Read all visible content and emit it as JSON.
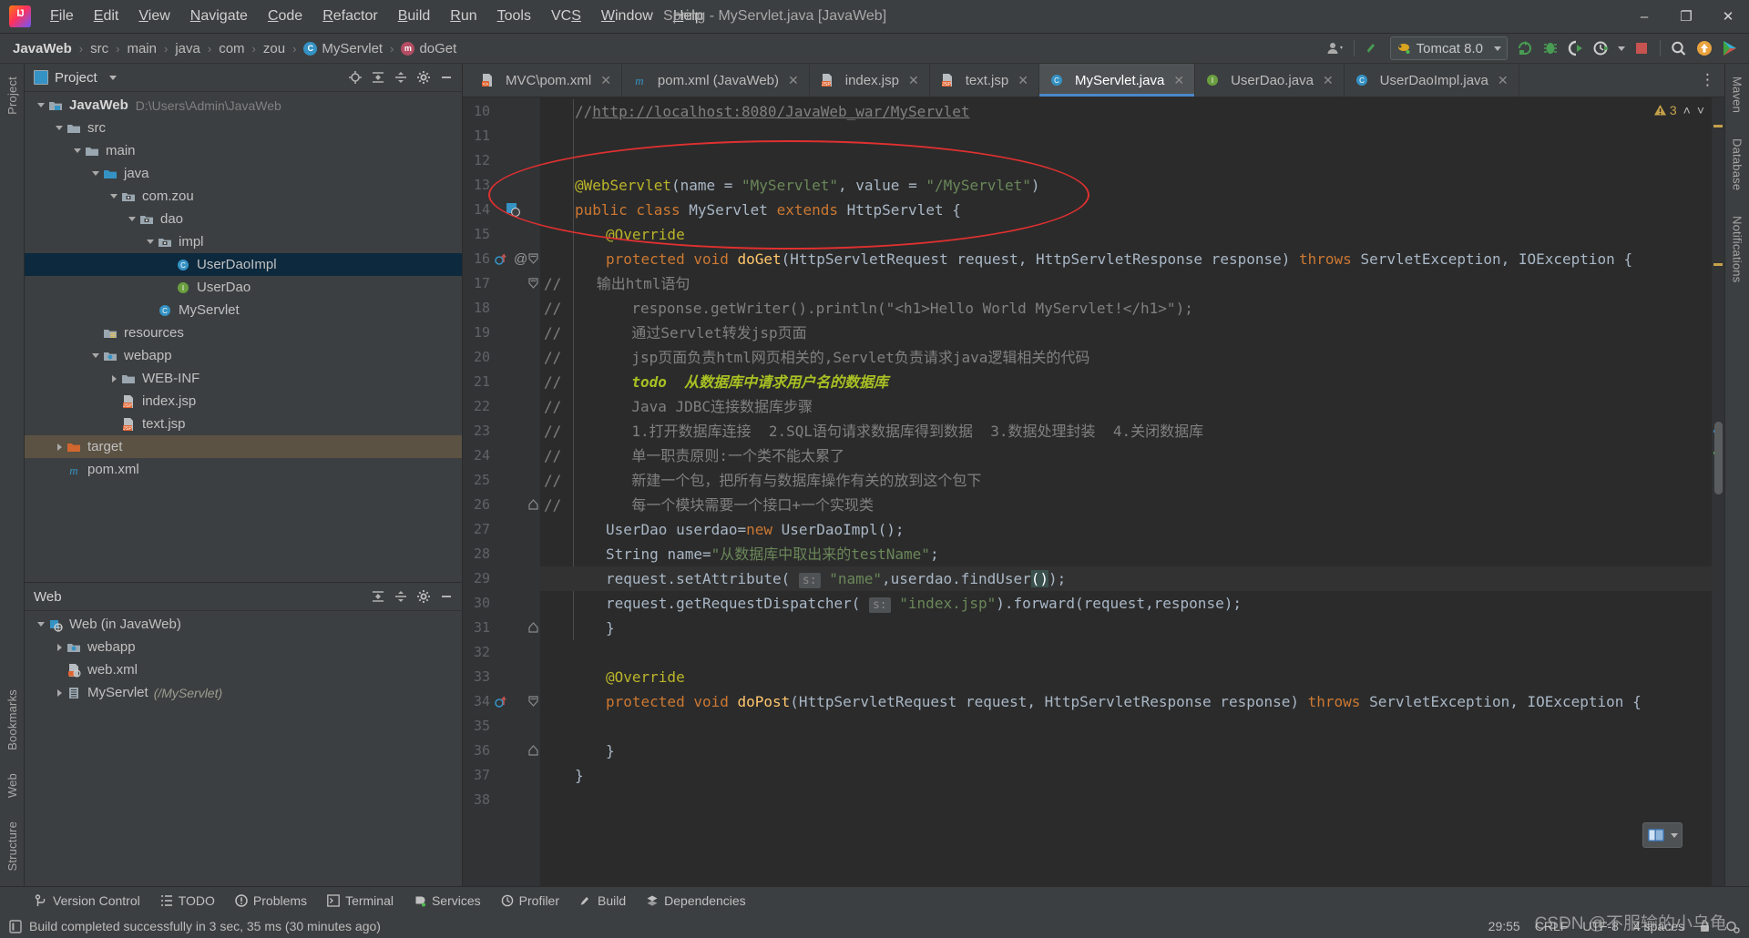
{
  "window": {
    "title": "Spring - MyServlet.java [JavaWeb]",
    "minimize": "–",
    "maximize": "❐",
    "close": "✕"
  },
  "menubar": [
    {
      "label": "File",
      "mnemonic": "F"
    },
    {
      "label": "Edit",
      "mnemonic": "E"
    },
    {
      "label": "View",
      "mnemonic": "V"
    },
    {
      "label": "Navigate",
      "mnemonic": "N"
    },
    {
      "label": "Code",
      "mnemonic": "C"
    },
    {
      "label": "Refactor",
      "mnemonic": "R"
    },
    {
      "label": "Build",
      "mnemonic": "B"
    },
    {
      "label": "Run",
      "mnemonic": "R"
    },
    {
      "label": "Tools",
      "mnemonic": "T"
    },
    {
      "label": "VCS",
      "mnemonic": "S"
    },
    {
      "label": "Window",
      "mnemonic": "W"
    },
    {
      "label": "Help",
      "mnemonic": "H"
    }
  ],
  "breadcrumb": [
    {
      "label": "JavaWeb",
      "icon": "",
      "bold": true
    },
    {
      "label": "src",
      "icon": ""
    },
    {
      "label": "main",
      "icon": ""
    },
    {
      "label": "java",
      "icon": ""
    },
    {
      "label": "com",
      "icon": ""
    },
    {
      "label": "zou",
      "icon": ""
    },
    {
      "label": "MyServlet",
      "icon": "class-icon"
    },
    {
      "label": "doGet",
      "icon": "method-icon"
    }
  ],
  "toolbar": {
    "account_label": "account-icon",
    "back_label": "back-arrow-icon",
    "run_config": "Tomcat 8.0",
    "buttons": [
      "rerun-icon",
      "debug-icon",
      "run-with-coverage-icon",
      "profiler-icon",
      "stop-icon",
      "search-everywhere-icon",
      "update-icon",
      "ide-icon"
    ]
  },
  "project_panel": {
    "title": "Project",
    "actions": [
      "locate-icon",
      "expand-all-icon",
      "collapse-all-icon",
      "settings-icon",
      "hide-icon"
    ],
    "tree": [
      {
        "label": "JavaWeb",
        "sub": "D:\\Users\\Admin\\JavaWeb",
        "depth": 0,
        "state": "open",
        "icon": "module-folder-icon",
        "bold": true
      },
      {
        "label": "src",
        "depth": 1,
        "state": "open",
        "icon": "folder-icon"
      },
      {
        "label": "main",
        "depth": 2,
        "state": "open",
        "icon": "folder-icon"
      },
      {
        "label": "java",
        "depth": 3,
        "state": "open",
        "icon": "source-folder-icon"
      },
      {
        "label": "com.zou",
        "depth": 4,
        "state": "open",
        "icon": "package-icon"
      },
      {
        "label": "dao",
        "depth": 5,
        "state": "open",
        "icon": "package-icon"
      },
      {
        "label": "impl",
        "depth": 6,
        "state": "open",
        "icon": "package-icon"
      },
      {
        "label": "UserDaoImpl",
        "depth": 7,
        "state": "leaf",
        "icon": "class-icon",
        "selected": true
      },
      {
        "label": "UserDao",
        "depth": 7,
        "state": "leaf",
        "icon": "interface-icon"
      },
      {
        "label": "MyServlet",
        "depth": 6,
        "state": "leaf",
        "icon": "class-icon"
      },
      {
        "label": "resources",
        "depth": 3,
        "state": "leaf",
        "icon": "resource-folder-icon"
      },
      {
        "label": "webapp",
        "depth": 3,
        "state": "open",
        "icon": "web-folder-icon"
      },
      {
        "label": "WEB-INF",
        "depth": 4,
        "state": "closed",
        "icon": "folder-icon"
      },
      {
        "label": "index.jsp",
        "depth": 4,
        "state": "leaf",
        "icon": "jsp-icon"
      },
      {
        "label": "text.jsp",
        "depth": 4,
        "state": "leaf",
        "icon": "jsp-icon"
      },
      {
        "label": "target",
        "depth": 1,
        "state": "closed",
        "icon": "excluded-folder-icon",
        "highlighted": true
      },
      {
        "label": "pom.xml",
        "depth": 1,
        "state": "leaf",
        "icon": "maven-icon"
      }
    ]
  },
  "web_panel": {
    "title": "Web",
    "actions": [
      "expand-all-icon",
      "collapse-all-icon",
      "settings-icon",
      "hide-icon"
    ],
    "tree": [
      {
        "label": "Web (in JavaWeb)",
        "depth": 0,
        "state": "open",
        "icon": "web-module-icon"
      },
      {
        "label": "webapp",
        "depth": 1,
        "state": "closed",
        "icon": "web-folder-icon"
      },
      {
        "label": "web.xml",
        "depth": 1,
        "state": "leaf",
        "icon": "webxml-icon"
      },
      {
        "label": "MyServlet",
        "mapping": "(/MyServlet)",
        "depth": 1,
        "state": "closed",
        "icon": "servlet-icon"
      }
    ]
  },
  "left_strip": [
    "Project",
    "Bookmarks",
    "Web",
    "Structure"
  ],
  "right_strip": [
    "Maven",
    "Database",
    "Notifications"
  ],
  "editor_tabs": [
    {
      "label": "MVC\\pom.xml",
      "icon": "xml-icon",
      "active": false
    },
    {
      "label": "pom.xml (JavaWeb)",
      "icon": "maven-icon",
      "active": false
    },
    {
      "label": "index.jsp",
      "icon": "jsp-icon",
      "active": false
    },
    {
      "label": "text.jsp",
      "icon": "jsp-icon",
      "active": false
    },
    {
      "label": "MyServlet.java",
      "icon": "class-icon",
      "active": true
    },
    {
      "label": "UserDao.java",
      "icon": "interface-icon",
      "active": false
    },
    {
      "label": "UserDaoImpl.java",
      "icon": "class-icon",
      "active": false
    }
  ],
  "inspection": {
    "warning_count": "3",
    "warning_icon": "warning-triangle-icon",
    "up_icon": "˄",
    "down_icon": "˅"
  },
  "code": {
    "first_line": 10,
    "current_line": 29,
    "lines": [
      {
        "n": 10,
        "tokens": [
          {
            "t": "//",
            "c": "cmt"
          },
          {
            "t": "http://localhost:8080/JavaWeb_war/MyServlet",
            "c": "lnk"
          }
        ],
        "indent": 1
      },
      {
        "n": 11,
        "tokens": [],
        "indent": 0
      },
      {
        "n": 12,
        "tokens": [],
        "indent": 0
      },
      {
        "n": 13,
        "tokens": [
          {
            "t": "@WebServlet",
            "c": "ann"
          },
          {
            "t": "(name = ",
            "c": "typ"
          },
          {
            "t": "\"MyServlet\"",
            "c": "str"
          },
          {
            "t": ", value = ",
            "c": "typ"
          },
          {
            "t": "\"/MyServlet\"",
            "c": "str"
          },
          {
            "t": ")",
            "c": "typ"
          }
        ],
        "indent": 1
      },
      {
        "n": 14,
        "tokens": [
          {
            "t": "public class ",
            "c": "kw"
          },
          {
            "t": "MyServlet ",
            "c": "typ"
          },
          {
            "t": "extends ",
            "c": "kw"
          },
          {
            "t": "HttpServlet {",
            "c": "typ"
          }
        ],
        "indent": 1,
        "gutter": "bean-icon"
      },
      {
        "n": 15,
        "tokens": [
          {
            "t": "@Override",
            "c": "ann"
          }
        ],
        "indent": 2
      },
      {
        "n": 16,
        "tokens": [
          {
            "t": "protected void ",
            "c": "kw"
          },
          {
            "t": "doGet",
            "c": "fn"
          },
          {
            "t": "(HttpServletRequest request, HttpServletResponse response) ",
            "c": "typ"
          },
          {
            "t": "throws ",
            "c": "kw"
          },
          {
            "t": "ServletException, IOException {",
            "c": "typ"
          }
        ],
        "indent": 2,
        "gutter": "override-icon"
      },
      {
        "n": 17,
        "tokens": [
          {
            "t": "//    输出html语句",
            "c": "cmt"
          }
        ],
        "indent": 0,
        "raw_indent": "gut"
      },
      {
        "n": 18,
        "tokens": [
          {
            "t": "//        response.getWriter().println(\"<h1>Hello World MyServlet!</h1>\");",
            "c": "cmt"
          }
        ],
        "indent": 0,
        "raw_indent": "gut"
      },
      {
        "n": 19,
        "tokens": [
          {
            "t": "//        通过Servlet转发jsp页面",
            "c": "cmt"
          }
        ],
        "indent": 0,
        "raw_indent": "gut"
      },
      {
        "n": 20,
        "tokens": [
          {
            "t": "//        jsp页面负责html网页相关的,Servlet负责请求java逻辑相关的代码",
            "c": "cmt"
          }
        ],
        "indent": 0,
        "raw_indent": "gut"
      },
      {
        "n": 21,
        "tokens": [
          {
            "t": "//        ",
            "c": "cmt"
          },
          {
            "t": "todo  从数据库中请求用户名的数据库",
            "c": "todo"
          }
        ],
        "indent": 0,
        "raw_indent": "gut"
      },
      {
        "n": 22,
        "tokens": [
          {
            "t": "//        Java JDBC连接数据库步骤",
            "c": "cmt"
          }
        ],
        "indent": 0,
        "raw_indent": "gut"
      },
      {
        "n": 23,
        "tokens": [
          {
            "t": "//        1.打开数据库连接  2.SQL语句请求数据库得到数据  3.数据处理封装  4.关闭数据库",
            "c": "cmt"
          }
        ],
        "indent": 0,
        "raw_indent": "gut"
      },
      {
        "n": 24,
        "tokens": [
          {
            "t": "//        单一职责原则:一个类不能太累了",
            "c": "cmt"
          }
        ],
        "indent": 0,
        "raw_indent": "gut"
      },
      {
        "n": 25,
        "tokens": [
          {
            "t": "//        新建一个包，把所有与数据库操作有关的放到这个包下",
            "c": "cmt"
          }
        ],
        "indent": 0,
        "raw_indent": "gut"
      },
      {
        "n": 26,
        "tokens": [
          {
            "t": "//        每一个模块需要一个接口+一个实现类",
            "c": "cmt"
          }
        ],
        "indent": 0,
        "raw_indent": "gut"
      },
      {
        "n": 27,
        "tokens": [
          {
            "t": "UserDao userdao=",
            "c": "typ"
          },
          {
            "t": "new ",
            "c": "kw"
          },
          {
            "t": "UserDaoImpl();",
            "c": "typ"
          }
        ],
        "indent": 2
      },
      {
        "n": 28,
        "tokens": [
          {
            "t": "String ",
            "c": "typ"
          },
          {
            "t": "name=",
            "c": "typ2"
          },
          {
            "t": "\"从数据库中取出来的testName\"",
            "c": "str"
          },
          {
            "t": ";",
            "c": "typ"
          }
        ],
        "indent": 2
      },
      {
        "n": 29,
        "tokens": [
          {
            "t": "request.setAttribute( ",
            "c": "typ"
          },
          {
            "t": "s:",
            "c": "hint"
          },
          {
            "t": " ",
            "c": "typ"
          },
          {
            "t": "\"name\"",
            "c": "str"
          },
          {
            "t": ",userdao.findUser",
            "c": "typ"
          },
          {
            "t": "()",
            "c": "brhl"
          },
          {
            "t": ");",
            "c": "typ"
          }
        ],
        "indent": 2
      },
      {
        "n": 30,
        "tokens": [
          {
            "t": "request.getRequestDispatcher( ",
            "c": "typ"
          },
          {
            "t": "s:",
            "c": "hint"
          },
          {
            "t": " ",
            "c": "typ"
          },
          {
            "t": "\"index.jsp\"",
            "c": "str"
          },
          {
            "t": ").forward(request,response);",
            "c": "typ"
          }
        ],
        "indent": 2
      },
      {
        "n": 31,
        "tokens": [
          {
            "t": "}",
            "c": "typ"
          }
        ],
        "indent": 2
      },
      {
        "n": 32,
        "tokens": [],
        "indent": 0
      },
      {
        "n": 33,
        "tokens": [
          {
            "t": "@Override",
            "c": "ann"
          }
        ],
        "indent": 2
      },
      {
        "n": 34,
        "tokens": [
          {
            "t": "protected void ",
            "c": "kw"
          },
          {
            "t": "doPost",
            "c": "fn"
          },
          {
            "t": "(HttpServletRequest request, HttpServletResponse response) ",
            "c": "typ"
          },
          {
            "t": "throws ",
            "c": "kw"
          },
          {
            "t": "ServletException, IOException {",
            "c": "typ"
          }
        ],
        "indent": 2,
        "gutter": "override-icon"
      },
      {
        "n": 35,
        "tokens": [],
        "indent": 0
      },
      {
        "n": 36,
        "tokens": [
          {
            "t": "}",
            "c": "typ"
          }
        ],
        "indent": 2
      },
      {
        "n": 37,
        "tokens": [
          {
            "t": "}",
            "c": "typ"
          }
        ],
        "indent": 1
      },
      {
        "n": 38,
        "tokens": [],
        "indent": 0
      }
    ]
  },
  "tool_windows": [
    {
      "label": "Version Control",
      "icon": "branch-icon"
    },
    {
      "label": "TODO",
      "icon": "todo-icon"
    },
    {
      "label": "Problems",
      "icon": "problems-icon"
    },
    {
      "label": "Terminal",
      "icon": "terminal-icon"
    },
    {
      "label": "Services",
      "icon": "services-icon"
    },
    {
      "label": "Profiler",
      "icon": "profiler-icon"
    },
    {
      "label": "Build",
      "icon": "build-icon"
    },
    {
      "label": "Dependencies",
      "icon": "dependencies-icon"
    }
  ],
  "status": {
    "message": "Build completed successfully in 3 sec, 35 ms (30 minutes ago)",
    "message_icon": "build-status-icon",
    "caret": "29:55",
    "line_sep": "CRLF",
    "encoding": "UTF-8",
    "indent": "4 spaces",
    "lock_icon": "lock-icon",
    "inspector_icon": "inspector-icon"
  },
  "watermark": "CSDN @不服输的小乌龟",
  "colors": {
    "bg_chrome": "#3c3f41",
    "bg_editor": "#2b2b2b",
    "gutter": "#313335",
    "accent_tab": "#4a88c7",
    "selection": "#0d293e",
    "annotation_ellipse": "#e03030",
    "keyword": "#cc7832",
    "string": "#6a8759",
    "comment": "#808080",
    "annotation": "#bbb529",
    "todo": "#a8c023",
    "method": "#ffc66d"
  }
}
